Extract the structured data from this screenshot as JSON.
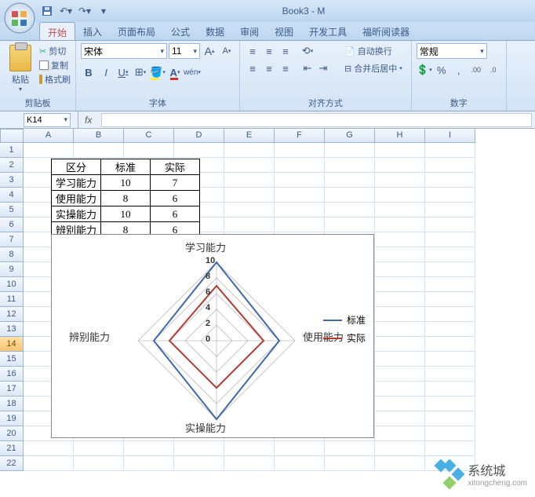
{
  "title": "Book3 - M",
  "tabs": [
    "开始",
    "插入",
    "页面布局",
    "公式",
    "数据",
    "审阅",
    "视图",
    "开发工具",
    "福昕阅读器"
  ],
  "active_tab": 0,
  "clipboard": {
    "paste": "粘贴",
    "cut": "剪切",
    "copy": "复制",
    "brush": "格式刷",
    "group": "剪贴板"
  },
  "font": {
    "name": "宋体",
    "size": "11",
    "group": "字体"
  },
  "align": {
    "wrap": "自动换行",
    "merge": "合并后居中",
    "group": "对齐方式"
  },
  "number": {
    "format": "常规",
    "group": "数字"
  },
  "namebox": "K14",
  "columns": [
    "A",
    "B",
    "C",
    "D",
    "E",
    "F",
    "G",
    "H",
    "I"
  ],
  "rowcount": 22,
  "selected_row": 14,
  "table": {
    "headers": [
      "区分",
      "标准",
      "实际"
    ],
    "rows": [
      [
        "学习能力",
        "10",
        "7"
      ],
      [
        "使用能力",
        "8",
        "6"
      ],
      [
        "实操能力",
        "10",
        "6"
      ],
      [
        "辨别能力",
        "8",
        "6"
      ]
    ]
  },
  "chart_data": {
    "type": "radar",
    "categories": [
      "学习能力",
      "使用能力",
      "实操能力",
      "辨别能力"
    ],
    "series": [
      {
        "name": "标准",
        "color": "#4169aa",
        "values": [
          10,
          8,
          10,
          8
        ]
      },
      {
        "name": "实际",
        "color": "#b43a2f",
        "values": [
          7,
          6,
          6,
          6
        ]
      }
    ],
    "ticks": [
      0,
      2,
      4,
      6,
      8,
      10
    ],
    "max": 10
  },
  "watermark": {
    "text": "系统城",
    "url": "xitongcheng.com"
  }
}
